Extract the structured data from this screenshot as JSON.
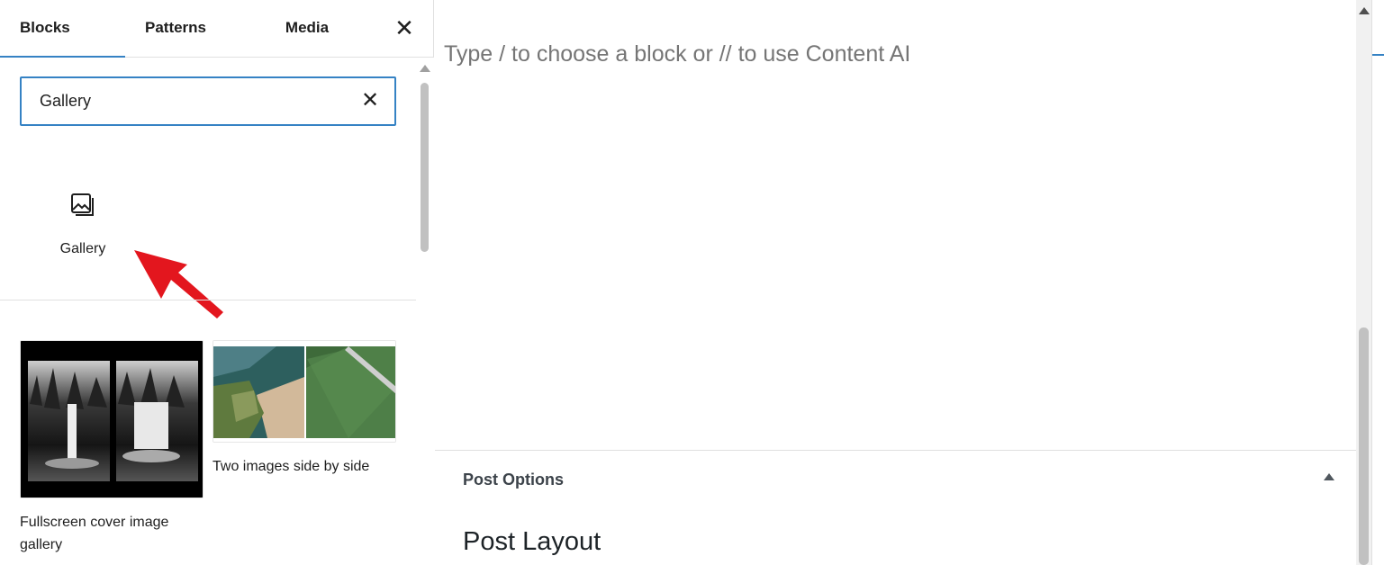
{
  "inserter": {
    "tabs": [
      {
        "label": "Blocks",
        "active": true
      },
      {
        "label": "Patterns",
        "active": false
      },
      {
        "label": "Media",
        "active": false
      }
    ],
    "close_icon": "close-icon",
    "search": {
      "value": "Gallery",
      "clear_icon": "close-icon"
    },
    "block_results": [
      {
        "label": "Gallery",
        "icon": "gallery-icon"
      }
    ],
    "pattern_results": [
      {
        "label": "Fullscreen cover image gallery"
      },
      {
        "label": "Two images side by side"
      }
    ]
  },
  "editor": {
    "placeholder": "Type / to choose a block or // to use Content AI",
    "post_options": {
      "title": "Post Options",
      "toggle_icon": "caret-up-icon"
    },
    "post_layout_title": "Post Layout"
  },
  "colors": {
    "accent": "#3582c4",
    "annotation_arrow": "#e3161e",
    "placeholder_text": "#757575"
  }
}
